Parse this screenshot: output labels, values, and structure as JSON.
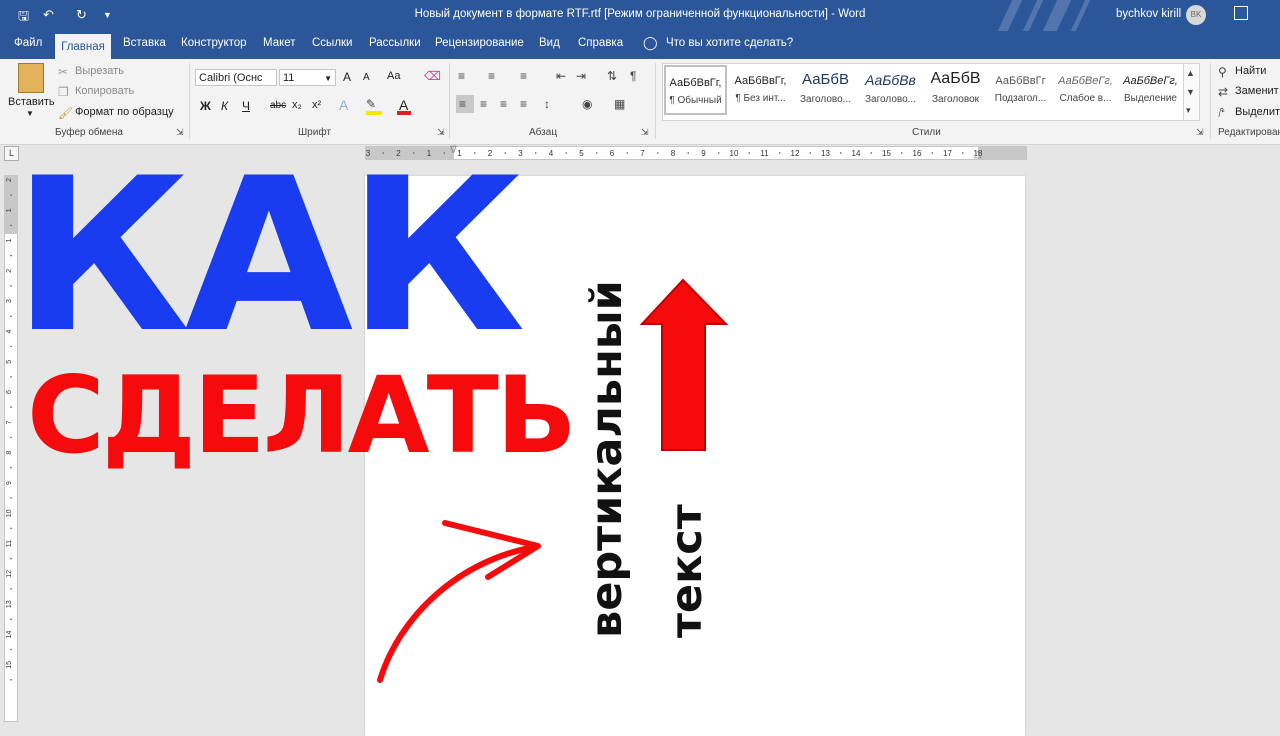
{
  "titlebar": {
    "doc_title": "Новый документ в формате RTF.rtf [Режим ограниченной функциональности] - Word",
    "user_name": "bychkov kirill",
    "avatar_initials": "BK",
    "qat": {
      "save_icon": "save-icon",
      "undo_icon": "undo-icon",
      "redo_icon": "redo-icon",
      "customize_icon": "chevron-down-icon"
    },
    "brand_color": "#2b579a"
  },
  "tabs": [
    {
      "label": "Файл"
    },
    {
      "label": "Главная",
      "selected": true
    },
    {
      "label": "Вставка"
    },
    {
      "label": "Конструктор"
    },
    {
      "label": "Макет"
    },
    {
      "label": "Ссылки"
    },
    {
      "label": "Рассылки"
    },
    {
      "label": "Рецензирование"
    },
    {
      "label": "Вид"
    },
    {
      "label": "Справка"
    }
  ],
  "tell_me": "Что вы хотите сделать?",
  "clipboard": {
    "paste": "Вставить",
    "cut": "Вырезать",
    "copy": "Копировать",
    "format_painter": "Формат по образцу",
    "group_label": "Буфер обмена"
  },
  "font": {
    "font_name": "Calibri (Оснс",
    "font_size": "11",
    "bold": "Ж",
    "italic": "К",
    "underline": "Ч",
    "strike": "abc",
    "subscript": "x₂",
    "superscript": "x²",
    "text_effects": "A",
    "grow": "A",
    "shrink": "A",
    "change_case": "Aa",
    "font_color_letter": "A",
    "font_color": "#e02020",
    "highlight_color": "#f5e800",
    "group_label": "Шрифт"
  },
  "paragraph": {
    "group_label": "Абзац"
  },
  "styles": {
    "items": [
      {
        "sample": "АаБбВвГг,",
        "name": "¶ Обычный",
        "selected": true
      },
      {
        "sample": "АаБбВвГг,",
        "name": "¶ Без инт..."
      },
      {
        "sample": "АаБбВ",
        "name": "Заголово..."
      },
      {
        "sample": "АаБбВв",
        "name": "Заголово..."
      },
      {
        "sample": "АаБбВ",
        "name": "Заголовок"
      },
      {
        "sample": "АаБбВвГг",
        "name": "Подзагол..."
      },
      {
        "sample": "АаБбВеГг,",
        "name": "Слабое в..."
      },
      {
        "sample": "АаБбВеГг,",
        "name": "Выделение"
      }
    ],
    "group_label": "Стили"
  },
  "editing": {
    "find": "Найти",
    "replace": "Заменит",
    "select": "Выделит",
    "group_label": "Редактирован"
  },
  "ruler": {
    "h_labels": [
      "3",
      "2",
      "1",
      "1",
      "2",
      "3",
      "4",
      "5",
      "6",
      "7",
      "8",
      "9",
      "10",
      "11",
      "12",
      "13",
      "14",
      "15",
      "16",
      "17",
      "18"
    ],
    "v_labels": [
      "2",
      "1",
      "1",
      "2",
      "3",
      "4",
      "5",
      "6",
      "7",
      "8",
      "9",
      "10",
      "11",
      "12",
      "13",
      "14",
      "15"
    ],
    "corner": "L"
  },
  "overlay": {
    "headline_1": "КАК",
    "headline_2": "СДЕЛАТЬ",
    "vertical_1": "вертикальный",
    "vertical_2": "текст",
    "blue": "#1a3cf0",
    "red": "#f50b0b"
  }
}
